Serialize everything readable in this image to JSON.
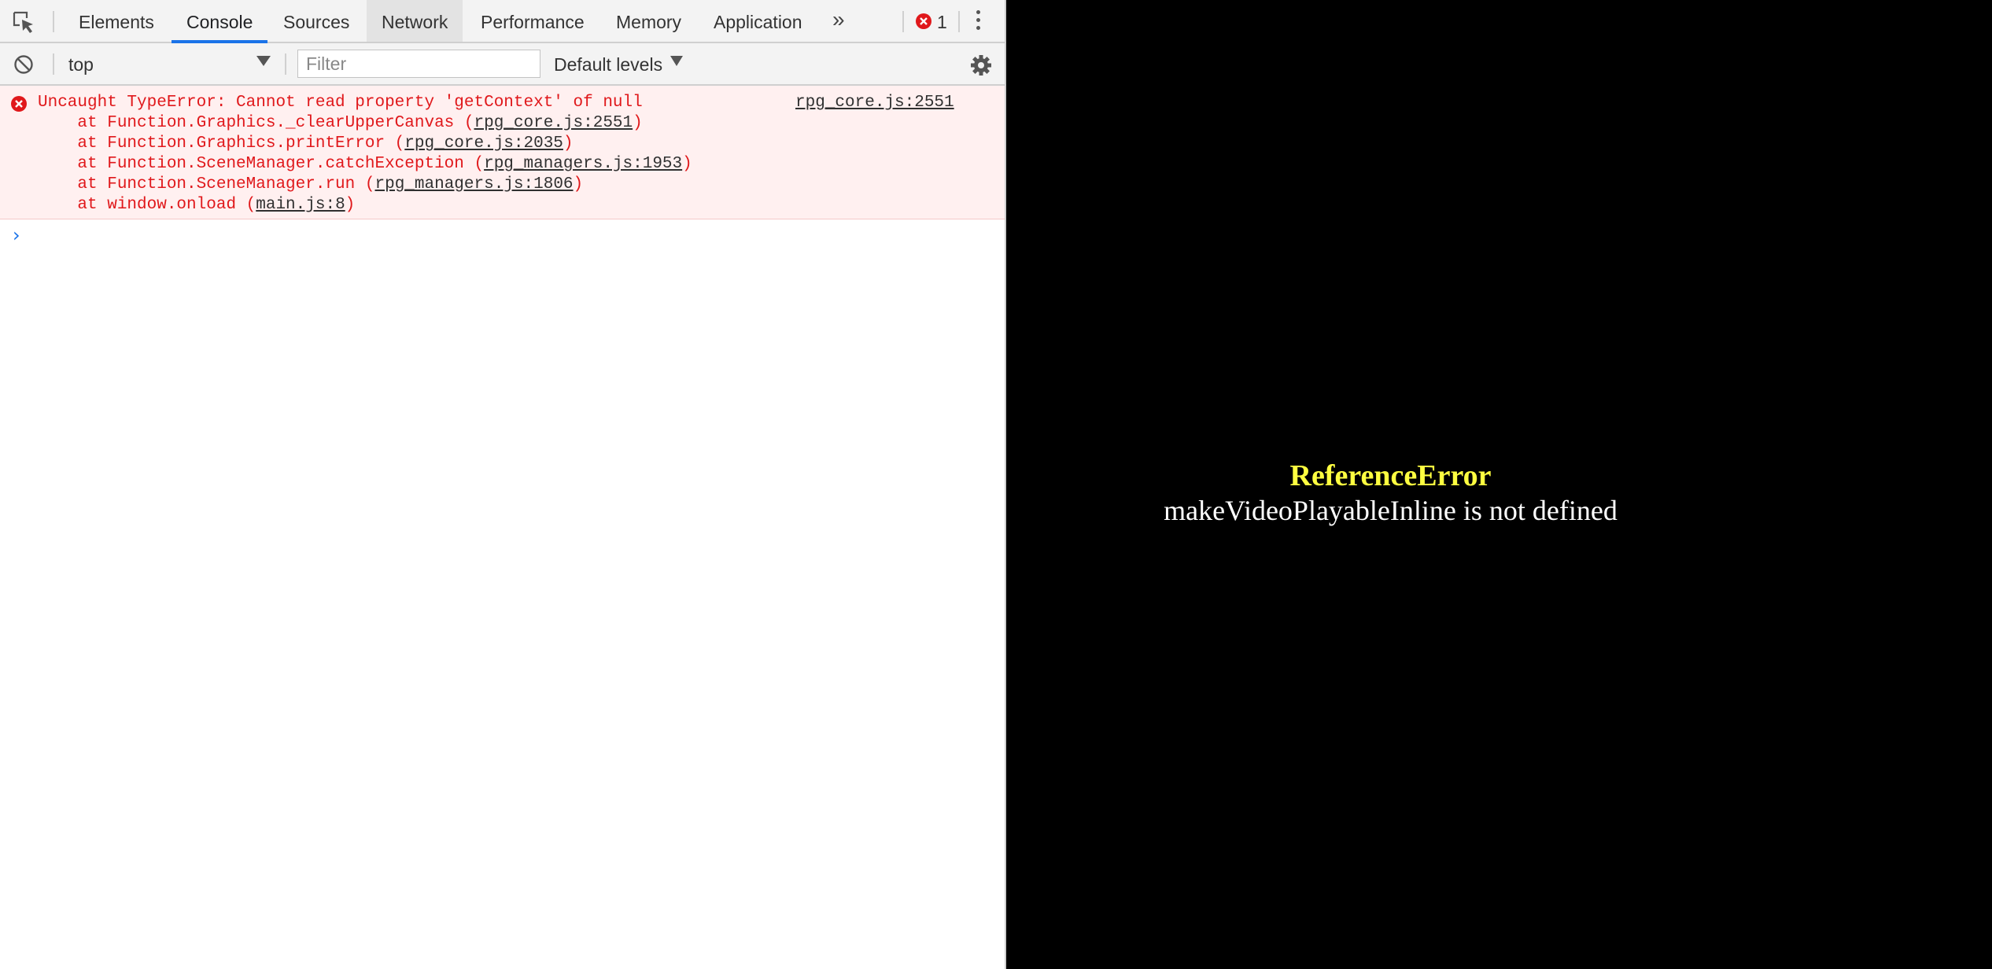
{
  "tabs": [
    "Elements",
    "Console",
    "Sources",
    "Network",
    "Performance",
    "Memory",
    "Application"
  ],
  "error_count": "1",
  "toolbar": {
    "context": "top",
    "filter_placeholder": "Filter",
    "levels": "Default levels"
  },
  "console": {
    "error_message": "Uncaught TypeError: Cannot read property 'getContext' of null",
    "error_source": "rpg_core.js:2551",
    "stack": [
      {
        "prefix": "    at Function.Graphics._clearUpperCanvas (",
        "link": "rpg_core.js:2551",
        "suffix": ")"
      },
      {
        "prefix": "    at Function.Graphics.printError (",
        "link": "rpg_core.js:2035",
        "suffix": ")"
      },
      {
        "prefix": "    at Function.SceneManager.catchException (",
        "link": "rpg_managers.js:1953",
        "suffix": ")"
      },
      {
        "prefix": "    at Function.SceneManager.run (",
        "link": "rpg_managers.js:1806",
        "suffix": ")"
      },
      {
        "prefix": "    at window.onload (",
        "link": "main.js:8",
        "suffix": ")"
      }
    ],
    "prompt": "›"
  },
  "game": {
    "error_title": "ReferenceError",
    "error_message": "makeVideoPlayableInline is not defined"
  },
  "colors": {
    "active_tab": "#1a73e8",
    "error_text": "#e0181b",
    "error_bg": "#fff0f0",
    "game_error_title": "#ffff40"
  }
}
